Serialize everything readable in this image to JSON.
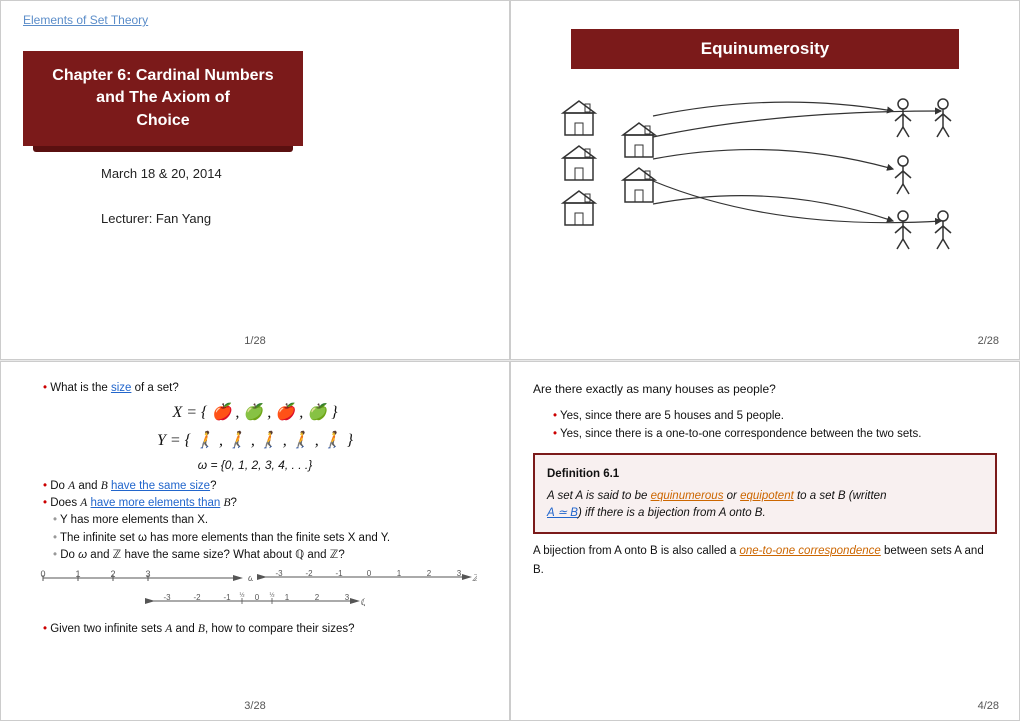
{
  "slide1": {
    "top_link": "Elements of Set Theory",
    "title_line1": "Chapter 6: Cardinal Numbers and The Axiom of",
    "title_line2": "Choice",
    "date": "March 18 & 20, 2014",
    "lecturer": "Lecturer: Fan Yang",
    "page_num": "1/28"
  },
  "slide2": {
    "header": "Equinumerosity",
    "page_num": "2/28"
  },
  "slide3": {
    "q1_prefix": "What is the ",
    "q1_link": "size",
    "q1_suffix": " of a set?",
    "set_X": "X = {",
    "set_X_suffix": "}",
    "set_Y": "Y = {",
    "set_Y_suffix": "}",
    "omega_def": "ω = {0, 1, 2, 3, 4, . . .}",
    "q2": "Do A and B have the same size?",
    "q3_prefix": "Does A ",
    "q3_link": "have more elements than",
    "q3_suffix": " B?",
    "sub1": "Y has more elements than X.",
    "sub2": "The infinite set ω has more elements than the finite sets X and Y.",
    "sub3_prefix": "Do ω and ℤ have the same size? What about ℚ and ℤ?",
    "page_num": "3/28"
  },
  "slide4": {
    "question": "Are there exactly as many houses as people?",
    "bullet1": "Yes, since there are 5 houses and 5 people.",
    "bullet2": "Yes, since there is a one-to-one correspondence between the two sets.",
    "def_title": "Definition 6.1",
    "def_text1": "A set A is said to be ",
    "def_equinumerous": "equinumerous",
    "def_or": " or ",
    "def_equipotent": "equipotent",
    "def_text2": " to a set B (written",
    "def_text3": "A ≃ B) iff there is a bijection from A onto B.",
    "bijection_text": "A bijection from A onto B is also called a ",
    "bijection_link": "one-to-one correspondence",
    "bijection_text2": " between sets A and B.",
    "page_num": "4/28"
  }
}
